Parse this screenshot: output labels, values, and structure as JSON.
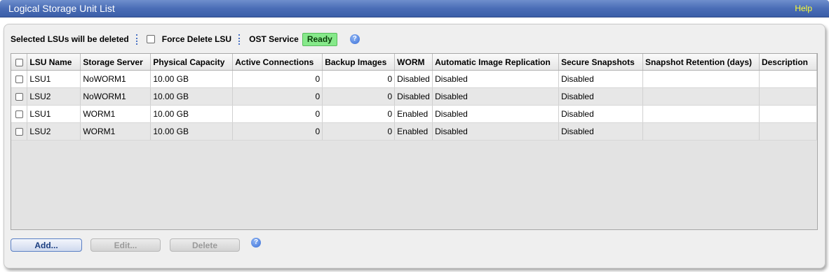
{
  "window": {
    "title": "Logical Storage Unit List",
    "help_label": "Help"
  },
  "toolbar": {
    "selected_label": "Selected LSUs will be deleted",
    "force_delete_label": "Force Delete LSU",
    "ost_service_label": "OST Service",
    "ost_status": "Ready",
    "ost_status_color": "#86e98a",
    "help_icon": "question-circle-icon"
  },
  "table": {
    "columns": [
      "LSU Name",
      "Storage Server",
      "Physical Capacity",
      "Active Connections",
      "Backup Images",
      "WORM",
      "Automatic Image Replication",
      "Secure Snapshots",
      "Snapshot Retention (days)",
      "Description"
    ],
    "rows": [
      [
        "LSU1",
        "NoWORM1",
        "10.00 GB",
        "0",
        "0",
        "Disabled",
        "Disabled",
        "Disabled",
        "",
        ""
      ],
      [
        "LSU2",
        "NoWORM1",
        "10.00 GB",
        "0",
        "0",
        "Disabled",
        "Disabled",
        "Disabled",
        "",
        ""
      ],
      [
        "LSU1",
        "WORM1",
        "10.00 GB",
        "0",
        "0",
        "Enabled",
        "Disabled",
        "Disabled",
        "",
        ""
      ],
      [
        "LSU2",
        "WORM1",
        "10.00 GB",
        "0",
        "0",
        "Enabled",
        "Disabled",
        "Disabled",
        "",
        ""
      ]
    ]
  },
  "buttons": {
    "add": "Add...",
    "edit": "Edit...",
    "delete": "Delete"
  },
  "colors": {
    "titlebar": "#4a6db6",
    "help_link": "#ffff33",
    "accent": "#3a6fd6"
  }
}
